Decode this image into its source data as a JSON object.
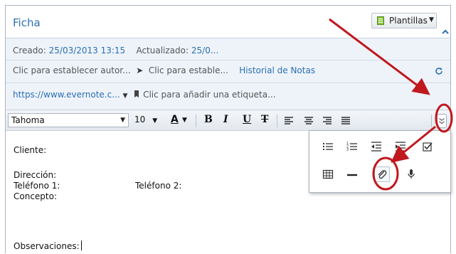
{
  "note": {
    "title": "Ficha",
    "templates_button": "Plantillas"
  },
  "meta": {
    "created_label": "Creado:",
    "created_value": "25/03/2013 13:15",
    "updated_label": "Actualizado:",
    "updated_value": "25/0...",
    "author_placeholder": "Clic para establecer autor...",
    "location_placeholder": "Clic para estable...",
    "history_link": "Historial de Notas",
    "source_url": "https://www.evernote.c...",
    "tag_placeholder": "Clic para añadir una etiqueta..."
  },
  "toolbar": {
    "font": "Tahoma",
    "size": "10",
    "text_color": "A",
    "bold": "B",
    "italic": "I",
    "underline": "U",
    "strike": "T"
  },
  "editor": {
    "line1": "Cliente:",
    "line2": "Dirección:",
    "line3": "Teléfono 1:",
    "line3b": "Teléfono 2:",
    "line4": "Concepto:",
    "line5": "Observaciones:"
  },
  "popup_tools": [
    "bullet-list-icon",
    "numbered-list-icon",
    "outdent-icon",
    "indent-icon",
    "checkbox-icon",
    "table-icon",
    "horizontal-rule-icon",
    "attachment-icon",
    "microphone-icon"
  ],
  "colors": {
    "accent_blue": "#2a6fb3",
    "annotation_red": "#c0181d",
    "meta_background": "#eef3fa"
  }
}
